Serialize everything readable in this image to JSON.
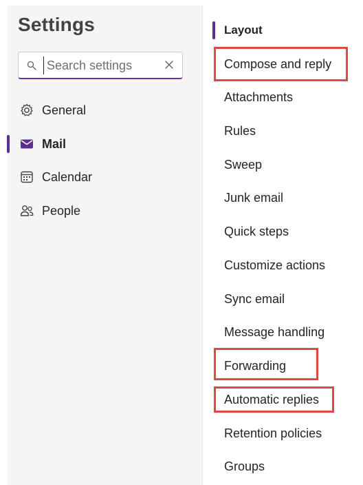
{
  "settings": {
    "title": "Settings",
    "search": {
      "placeholder": "Search settings",
      "value": ""
    }
  },
  "nav": {
    "items": [
      {
        "label": "General",
        "icon": "gear-icon",
        "selected": false
      },
      {
        "label": "Mail",
        "icon": "mail-icon",
        "selected": true
      },
      {
        "label": "Calendar",
        "icon": "calendar-icon",
        "selected": false
      },
      {
        "label": "People",
        "icon": "people-icon",
        "selected": false
      }
    ]
  },
  "mail_sections": {
    "items": [
      {
        "label": "Layout",
        "selected": true,
        "highlighted": false
      },
      {
        "label": "Compose and reply",
        "selected": false,
        "highlighted": true
      },
      {
        "label": "Attachments",
        "selected": false,
        "highlighted": false
      },
      {
        "label": "Rules",
        "selected": false,
        "highlighted": false
      },
      {
        "label": "Sweep",
        "selected": false,
        "highlighted": false
      },
      {
        "label": "Junk email",
        "selected": false,
        "highlighted": false
      },
      {
        "label": "Quick steps",
        "selected": false,
        "highlighted": false
      },
      {
        "label": "Customize actions",
        "selected": false,
        "highlighted": false
      },
      {
        "label": "Sync email",
        "selected": false,
        "highlighted": false
      },
      {
        "label": "Message handling",
        "selected": false,
        "highlighted": false
      },
      {
        "label": "Forwarding",
        "selected": false,
        "highlighted": true
      },
      {
        "label": "Automatic replies",
        "selected": false,
        "highlighted": true
      },
      {
        "label": "Retention policies",
        "selected": false,
        "highlighted": false
      },
      {
        "label": "Groups",
        "selected": false,
        "highlighted": false
      }
    ]
  },
  "colors": {
    "accent": "#5c2e91",
    "highlight": "#e04848",
    "pane_background": "#f5f5f5"
  }
}
